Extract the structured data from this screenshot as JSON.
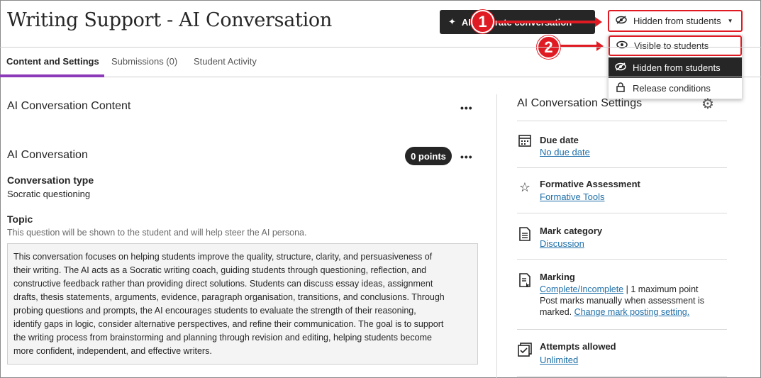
{
  "header": {
    "title": "Writing Support - AI Conversation",
    "generate_button": "AI generate conversation",
    "visibility_button": "Hidden from students"
  },
  "callouts": {
    "one": "1",
    "two": "2"
  },
  "visibility_menu": {
    "items": [
      {
        "label": "Visible to students",
        "icon": "eye-icon"
      },
      {
        "label": "Hidden from students",
        "icon": "eye-slash-icon"
      },
      {
        "label": "Release conditions",
        "icon": "lock-icon"
      }
    ]
  },
  "tabs": [
    {
      "label": "Content and Settings"
    },
    {
      "label": "Submissions (0)"
    },
    {
      "label": "Student Activity"
    }
  ],
  "content": {
    "section_title": "AI Conversation Content",
    "conversation_title": "AI Conversation",
    "points_badge": "0 points",
    "conversation_type_label": "Conversation type",
    "conversation_type_value": "Socratic questioning",
    "topic_label": "Topic",
    "topic_hint": "This question will be shown to the student and will help steer the AI persona.",
    "topic_lines": [
      "This conversation focuses on helping students improve the quality, structure, clarity, and persuasiveness of",
      "their writing. The AI acts as a Socratic writing coach, guiding students through questioning, reflection, and",
      "constructive feedback rather than providing direct solutions. Students can discuss essay ideas, assignment",
      "drafts, thesis statements, arguments, evidence, paragraph organisation, transitions, and conclusions. Through",
      "probing questions and prompts, the AI encourages students to evaluate the strength of their reasoning,",
      "identify gaps in logic, consider alternative perspectives, and refine their communication. The goal is to support",
      "the writing process from brainstorming and planning through revision and editing, helping students become",
      "more confident, independent, and effective writers."
    ]
  },
  "settings": {
    "title": "AI Conversation Settings",
    "due_date": {
      "label": "Due date",
      "link": "No due date"
    },
    "formative": {
      "label": "Formative Assessment",
      "link": "Formative Tools"
    },
    "mark_category": {
      "label": "Mark category",
      "link": "Discussion"
    },
    "marking": {
      "label": "Marking",
      "link": "Complete/Incomplete",
      "suffix": " | 1 maximum point",
      "line2": "Post marks manually when assessment is",
      "line3_prefix": "marked. ",
      "line3_link": "Change mark posting setting."
    },
    "attempts": {
      "label": "Attempts allowed",
      "link": "Unlimited"
    }
  },
  "colors": {
    "accent": "#8c3ab8",
    "callout": "#e01a22",
    "link": "#1f6fa8",
    "dark": "#262626"
  }
}
